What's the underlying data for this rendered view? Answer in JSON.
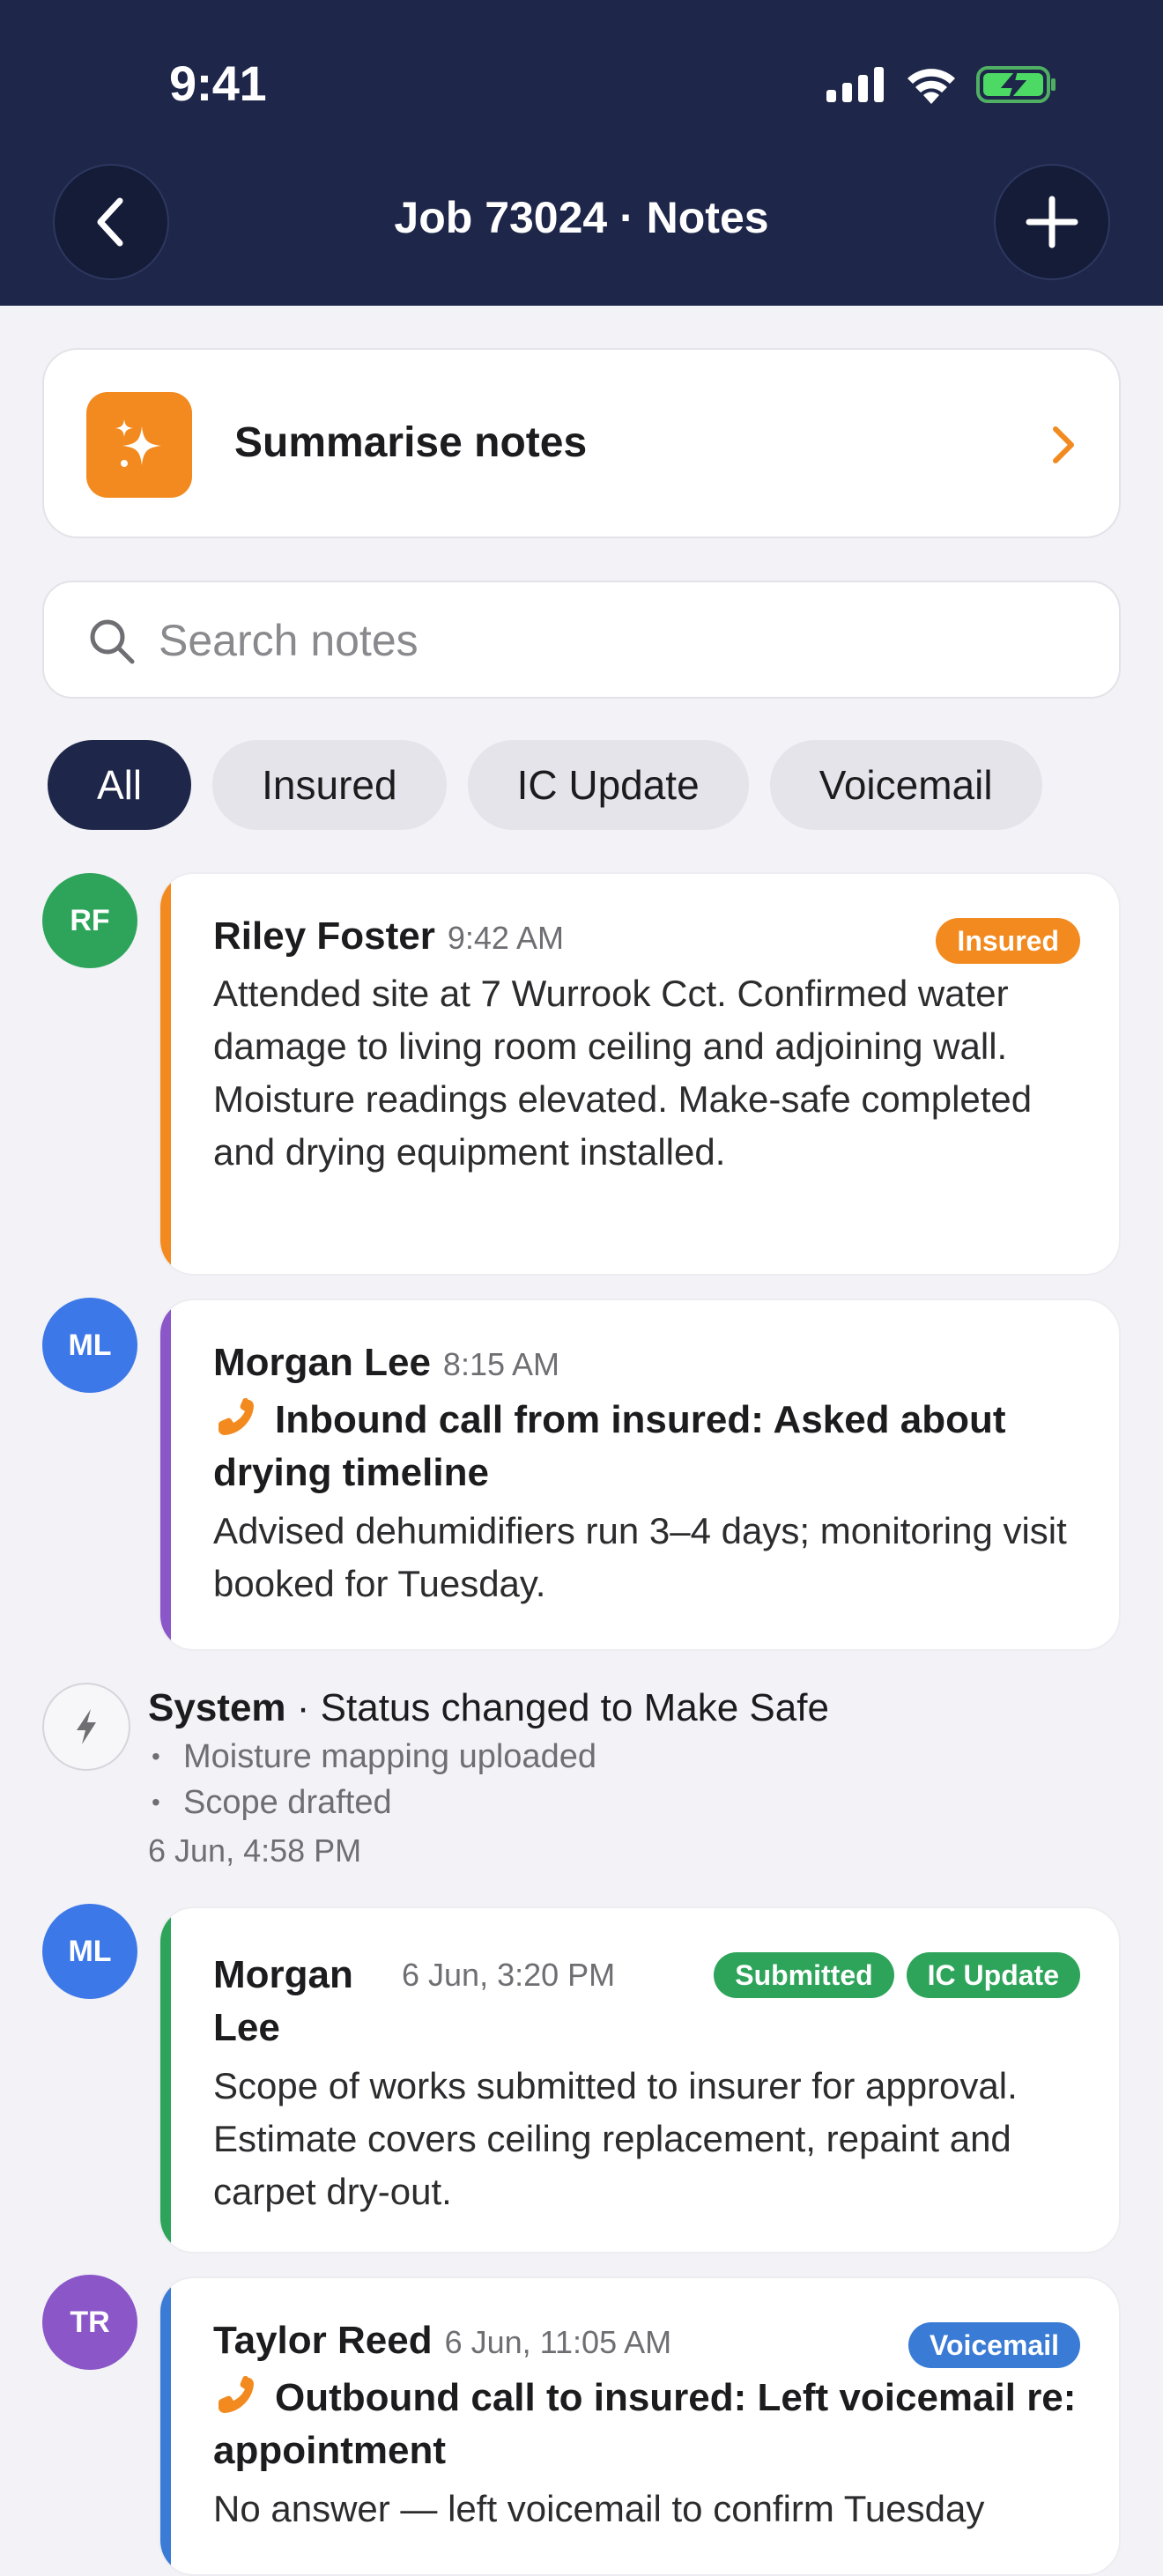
{
  "status_bar": {
    "time": "9:41"
  },
  "header": {
    "title": "Job 73024 · Notes"
  },
  "summarise": {
    "label": "Summarise notes"
  },
  "search": {
    "placeholder": "Search notes",
    "value": ""
  },
  "filters": [
    {
      "label": "All",
      "active": true
    },
    {
      "label": "Insured",
      "active": false
    },
    {
      "label": "IC Update",
      "active": false
    },
    {
      "label": "Voicemail",
      "active": false
    }
  ],
  "colors": {
    "header": "#1e2749",
    "orange": "#f28a1f",
    "purple": "#8a56c8",
    "green": "#2ea45a",
    "blue": "#3a7bd5"
  },
  "notes": [
    {
      "initials": "RF",
      "author": "Riley Foster",
      "time": "9:42 AM",
      "badges": [
        "Insured"
      ],
      "body": "Attended site at 7 Wurrook Cct. Confirmed water damage to living room ceiling and adjoining wall. Moisture readings elevated. Make-safe completed and drying equipment installed."
    },
    {
      "initials": "ML",
      "author": "Morgan Lee",
      "time": "8:15 AM",
      "call": "Inbound call from insured:  Asked about drying timeline",
      "body": "Advised dehumidifiers run 3–4 days; monitoring visit booked for Tuesday."
    },
    {
      "initials": "ML",
      "author": "Morgan Lee",
      "time": "6 Jun, 3:20 PM",
      "badges": [
        "Submitted",
        "IC Update"
      ],
      "body": "Scope of works submitted to insurer for approval. Estimate covers ceiling replacement, repaint and carpet dry-out."
    },
    {
      "initials": "TR",
      "author": "Taylor Reed",
      "time": "6 Jun, 11:05 AM",
      "badges": [
        "Voicemail"
      ],
      "call": "Outbound call to insured:  Left voicemail re: appointment",
      "body": "No answer — left voicemail to confirm Tuesday"
    }
  ],
  "system": {
    "label": "System",
    "text": " · Status changed to Make Safe",
    "items": [
      "Moisture mapping uploaded",
      "Scope drafted"
    ],
    "time": "6 Jun, 4:58 PM"
  }
}
